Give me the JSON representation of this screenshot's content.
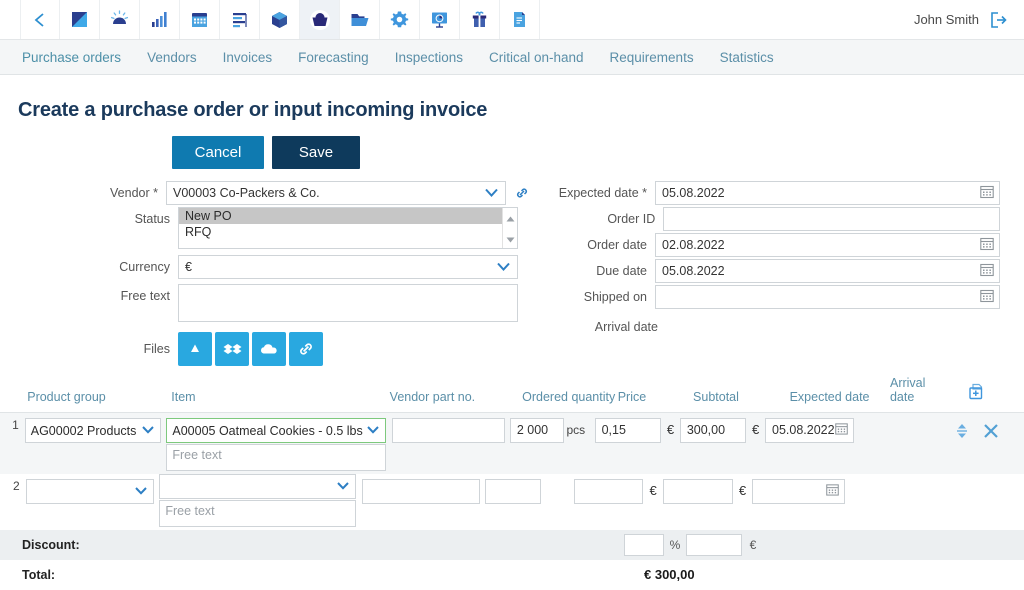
{
  "topbar": {
    "icons": [
      {
        "name": "back-chevron-icon",
        "label": "Back"
      },
      {
        "name": "dashboard-icon",
        "label": "Dashboard"
      },
      {
        "name": "gauge-icon",
        "label": "Gauge"
      },
      {
        "name": "bar-chart-icon",
        "label": "Reports"
      },
      {
        "name": "calendar-icon",
        "label": "Calendar"
      },
      {
        "name": "list-icon",
        "label": "Tasks"
      },
      {
        "name": "box-icon",
        "label": "Inventory"
      },
      {
        "name": "basket-icon",
        "label": "Purchasing"
      },
      {
        "name": "folder-icon",
        "label": "Documents"
      },
      {
        "name": "gear-icon",
        "label": "Settings"
      },
      {
        "name": "presentation-icon",
        "label": "Analytics"
      },
      {
        "name": "gift-icon",
        "label": "Products"
      },
      {
        "name": "file-icon",
        "label": "Files"
      }
    ],
    "active_index": 7,
    "user_name": "John Smith",
    "logout_icon": "logout-icon"
  },
  "nav": {
    "items": [
      {
        "label": "Purchase orders",
        "active": true
      },
      {
        "label": "Vendors",
        "active": false
      },
      {
        "label": "Invoices",
        "active": false
      },
      {
        "label": "Forecasting",
        "active": false
      },
      {
        "label": "Inspections",
        "active": false
      },
      {
        "label": "Critical on-hand",
        "active": false
      },
      {
        "label": "Requirements",
        "active": false
      },
      {
        "label": "Statistics",
        "active": false
      }
    ]
  },
  "page": {
    "title": "Create a purchase order or input incoming invoice"
  },
  "actions": {
    "cancel_label": "Cancel",
    "save_label": "Save"
  },
  "form_left": {
    "vendor_label": "Vendor *",
    "vendor_value": "V00003 Co-Packers & Co.",
    "vendor_link_icon": "link-icon",
    "status_label": "Status",
    "status_options": [
      "New PO",
      "RFQ"
    ],
    "status_selected": "New PO",
    "currency_label": "Currency",
    "currency_value": "€",
    "free_text_label": "Free text",
    "free_text_value": "",
    "files_label": "Files",
    "file_buttons": [
      {
        "name": "google-drive-icon",
        "label": "Google Drive"
      },
      {
        "name": "dropbox-icon",
        "label": "Dropbox"
      },
      {
        "name": "onedrive-icon",
        "label": "OneDrive"
      },
      {
        "name": "link-icon",
        "label": "Link"
      }
    ]
  },
  "form_right": {
    "fields": [
      {
        "label": "Expected date *",
        "value": "05.08.2022",
        "calendar": true
      },
      {
        "label": "Order ID",
        "value": "",
        "calendar": false
      },
      {
        "label": "Order date",
        "value": "02.08.2022",
        "calendar": true
      },
      {
        "label": "Due date",
        "value": "05.08.2022",
        "calendar": true
      },
      {
        "label": "Shipped on",
        "value": "",
        "calendar": true
      },
      {
        "label": "Arrival date",
        "value": null,
        "calendar": false
      }
    ]
  },
  "table": {
    "headers": {
      "product_group": "Product group",
      "item": "Item",
      "vendor_part_no": "Vendor part no.",
      "ordered_quantity": "Ordered quantity",
      "price": "Price",
      "subtotal": "Subtotal",
      "expected_date": "Expected date",
      "arrival_date": "Arrival date",
      "add_icon": "add-row-icon"
    },
    "free_text_placeholder": "Free text",
    "rows": [
      {
        "num": "1",
        "product_group": "AG00002 Products",
        "item": "A00005 Oatmeal  Cookies - 0.5 lbs",
        "item_highlighted": true,
        "free_text": "",
        "vendor_part_no": "",
        "quantity": "2 000",
        "unit": "pcs",
        "price": "0,15",
        "currency": "€",
        "subtotal": "300,00",
        "subtotal_currency": "€",
        "expected_date": "05.08.2022",
        "arrival_date": "",
        "reorder_icon": "reorder-icon",
        "delete_icon": "delete-icon"
      },
      {
        "num": "2",
        "product_group": "",
        "item": "",
        "item_highlighted": false,
        "free_text": "",
        "vendor_part_no": "",
        "quantity": "",
        "unit": "",
        "price": "",
        "currency": "€",
        "subtotal": "",
        "subtotal_currency": "€",
        "expected_date": "",
        "arrival_date": "",
        "reorder_icon": "",
        "delete_icon": ""
      }
    ],
    "discount_label": "Discount:",
    "discount_percent": "",
    "discount_percent_symbol": "%",
    "discount_amount": "",
    "discount_currency": "€",
    "total_label": "Total:",
    "total_value": "€ 300,00"
  },
  "colors": {
    "accent_blue": "#0f7ab0",
    "dark_navy": "#0e3a5c",
    "nav_link": "#5b8fa8",
    "file_button": "#29a8e0",
    "highlight_green": "#7dc97d"
  }
}
